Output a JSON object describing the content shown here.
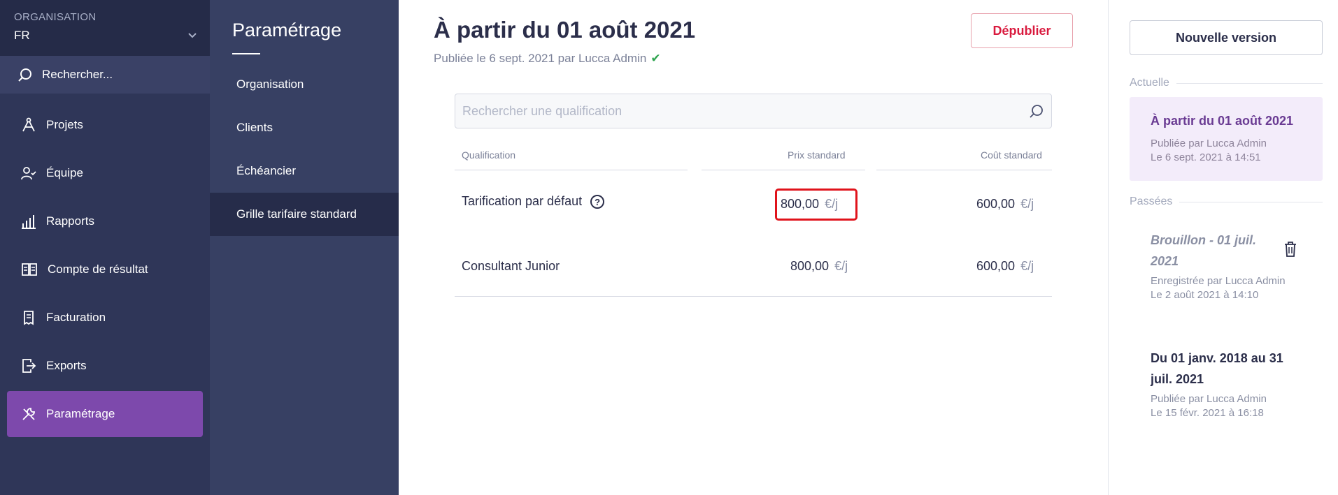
{
  "sidebar": {
    "org_label": "ORGANISATION",
    "org_value": "FR",
    "search_label": "Rechercher...",
    "items": [
      {
        "label": "Projets",
        "icon": "compass-icon"
      },
      {
        "label": "Équipe",
        "icon": "team-icon"
      },
      {
        "label": "Rapports",
        "icon": "chart-icon"
      },
      {
        "label": "Compte de résultat",
        "icon": "book-icon"
      },
      {
        "label": "Facturation",
        "icon": "receipt-icon"
      },
      {
        "label": "Exports",
        "icon": "export-icon"
      },
      {
        "label": "Paramétrage",
        "icon": "tools-icon"
      }
    ],
    "active_color": "#7d49ac"
  },
  "subnav": {
    "title": "Paramétrage",
    "items": [
      "Organisation",
      "Clients",
      "Échéancier",
      "Grille tarifaire standard"
    ]
  },
  "main": {
    "title": "À partir du 01 août 2021",
    "subtitle": "Publiée le 6 sept. 2021 par Lucca Admin",
    "unpublish_label": "Dépublier",
    "search_placeholder": "Rechercher une qualification",
    "table": {
      "headers": [
        "Qualification",
        "Prix standard",
        "Coût standard"
      ],
      "rows": [
        {
          "label": "Tarification par défaut",
          "price": "800,00",
          "cost": "600,00",
          "unit": "€/j",
          "help": "?"
        },
        {
          "label": "Consultant Junior",
          "price": "800,00",
          "cost": "600,00",
          "unit": "€/j"
        }
      ]
    }
  },
  "right": {
    "new_version_label": "Nouvelle version",
    "current_label": "Actuelle",
    "current": {
      "title": "À partir du 01 août 2021",
      "meta1": "Publiée par Lucca Admin",
      "meta2": "Le 6 sept. 2021 à 14:51"
    },
    "past_label": "Passées",
    "past": [
      {
        "title_line1": "Brouillon - 01 juil.",
        "title_line2": "2021",
        "meta1": "Enregistrée par Lucca Admin",
        "meta2": "Le 2 août 2021 à 14:10"
      },
      {
        "title_line1": "Du 01 janv. 2018 au 31",
        "title_line2": "juil. 2021",
        "meta1": "Publiée par Lucca Admin",
        "meta2": "Le 15 févr. 2021 à 16:18"
      }
    ]
  }
}
